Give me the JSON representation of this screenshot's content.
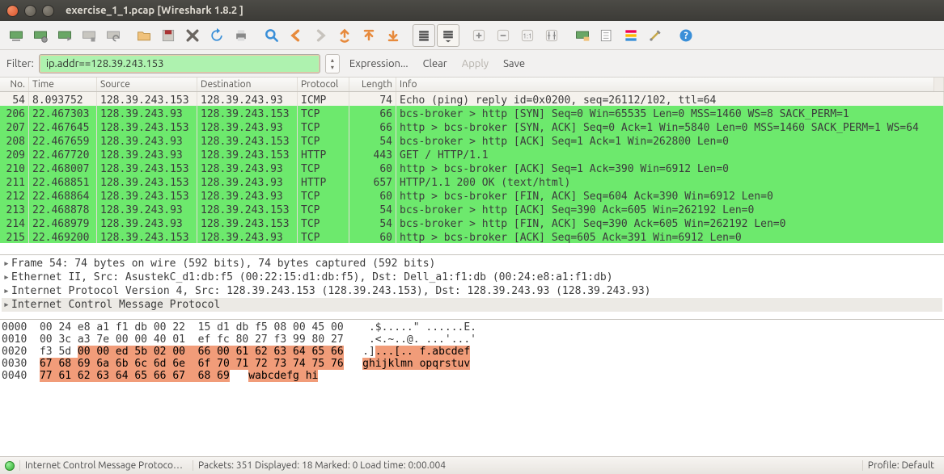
{
  "window": {
    "title": "exercise_1_1.pcap   [Wireshark 1.8.2 ]"
  },
  "filter": {
    "label": "Filter:",
    "value": "ip.addr==128.39.243.153",
    "expression": "Expression...",
    "clear": "Clear",
    "apply": "Apply",
    "save": "Save"
  },
  "columns": {
    "no": "No.",
    "time": "Time",
    "src": "Source",
    "dst": "Destination",
    "proto": "Protocol",
    "len": "Length",
    "info": "Info"
  },
  "packets": [
    {
      "no": "54",
      "time": "8.093752",
      "src": "128.39.243.153",
      "dst": "128.39.243.93",
      "proto": "ICMP",
      "len": "74",
      "info": "Echo (ping) reply    id=0x0200, seq=26112/102, ttl=64",
      "cls": "reply"
    },
    {
      "no": "206",
      "time": "22.467303",
      "src": "128.39.243.93",
      "dst": "128.39.243.153",
      "proto": "TCP",
      "len": "66",
      "info": "bcs-broker > http [SYN] Seq=0 Win=65535 Len=0 MSS=1460 WS=8 SACK_PERM=1",
      "cls": "tcp"
    },
    {
      "no": "207",
      "time": "22.467645",
      "src": "128.39.243.153",
      "dst": "128.39.243.93",
      "proto": "TCP",
      "len": "66",
      "info": "http > bcs-broker [SYN, ACK] Seq=0 Ack=1 Win=5840 Len=0 MSS=1460 SACK_PERM=1 WS=64",
      "cls": "tcp"
    },
    {
      "no": "208",
      "time": "22.467659",
      "src": "128.39.243.93",
      "dst": "128.39.243.153",
      "proto": "TCP",
      "len": "54",
      "info": "bcs-broker > http [ACK] Seq=1 Ack=1 Win=262800 Len=0",
      "cls": "tcp"
    },
    {
      "no": "209",
      "time": "22.467720",
      "src": "128.39.243.93",
      "dst": "128.39.243.153",
      "proto": "HTTP",
      "len": "443",
      "info": "GET / HTTP/1.1",
      "cls": "http"
    },
    {
      "no": "210",
      "time": "22.468007",
      "src": "128.39.243.153",
      "dst": "128.39.243.93",
      "proto": "TCP",
      "len": "60",
      "info": "http > bcs-broker [ACK] Seq=1 Ack=390 Win=6912 Len=0",
      "cls": "tcp"
    },
    {
      "no": "211",
      "time": "22.468851",
      "src": "128.39.243.153",
      "dst": "128.39.243.93",
      "proto": "HTTP",
      "len": "657",
      "info": "HTTP/1.1 200 OK  (text/html)",
      "cls": "http"
    },
    {
      "no": "212",
      "time": "22.468864",
      "src": "128.39.243.153",
      "dst": "128.39.243.93",
      "proto": "TCP",
      "len": "60",
      "info": "http > bcs-broker [FIN, ACK] Seq=604 Ack=390 Win=6912 Len=0",
      "cls": "tcp"
    },
    {
      "no": "213",
      "time": "22.468878",
      "src": "128.39.243.93",
      "dst": "128.39.243.153",
      "proto": "TCP",
      "len": "54",
      "info": "bcs-broker > http [ACK] Seq=390 Ack=605 Win=262192 Len=0",
      "cls": "tcp"
    },
    {
      "no": "214",
      "time": "22.468979",
      "src": "128.39.243.93",
      "dst": "128.39.243.153",
      "proto": "TCP",
      "len": "54",
      "info": "bcs-broker > http [FIN, ACK] Seq=390 Ack=605 Win=262192 Len=0",
      "cls": "tcp"
    },
    {
      "no": "215",
      "time": "22.469200",
      "src": "128.39.243.153",
      "dst": "128.39.243.93",
      "proto": "TCP",
      "len": "60",
      "info": "http > bcs-broker [ACK] Seq=605 Ack=391 Win=6912 Len=0",
      "cls": "tcp"
    }
  ],
  "details": [
    "Frame 54: 74 bytes on wire (592 bits), 74 bytes captured (592 bits)",
    "Ethernet II, Src: AsustekC_d1:db:f5 (00:22:15:d1:db:f5), Dst: Dell_a1:f1:db (00:24:e8:a1:f1:db)",
    "Internet Protocol Version 4, Src: 128.39.243.153 (128.39.243.153), Dst: 128.39.243.93 (128.39.243.93)",
    "Internet Control Message Protocol"
  ],
  "hex": [
    {
      "off": "0000",
      "b": "00 24 e8 a1 f1 db 00 22  15 d1 db f5 08 00 45 00",
      "a": ".$.....\" ......E."
    },
    {
      "off": "0010",
      "b": "00 3c a3 7e 00 00 40 01  ef fc 80 27 f3 99 80 27",
      "a": ".<.~..@. ...'...'"
    },
    {
      "off": "0020",
      "b": "f3 5d ",
      "bm": "00 00 ed 5b 02 00  66 00 61 62 63 64 65 66",
      "a": ".]",
      "am": "...[.. f.abcdef"
    },
    {
      "off": "0030",
      "b": "",
      "bm": "67 68 69 6a 6b 6c 6d 6e  6f 70 71 72 73 74 75 76",
      "a": "",
      "am": "ghijklmn opqrstuv"
    },
    {
      "off": "0040",
      "b": "",
      "bm": "77 61 62 63 64 65 66 67  68 69",
      "a": "",
      "am": "wabcdefg hi"
    }
  ],
  "status": {
    "proto": "Internet Control Message Protoco…",
    "counts": "Packets: 351 Displayed: 18 Marked: 0 Load time: 0:00.004",
    "profile": "Profile: Default"
  }
}
